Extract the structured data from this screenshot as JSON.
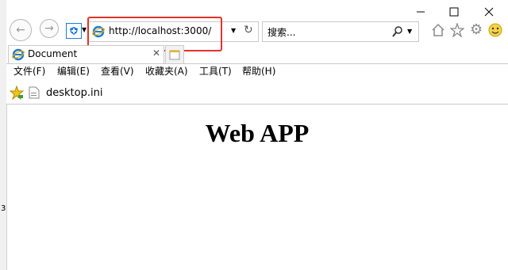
{
  "address_bar": {
    "url": "http://localhost:3000/"
  },
  "search": {
    "placeholder": "搜索..."
  },
  "tab": {
    "title": "Document"
  },
  "menu": {
    "items": [
      "文件(F)",
      "编辑(E)",
      "查看(V)",
      "收藏夹(A)",
      "工具(T)",
      "帮助(H)"
    ]
  },
  "favorites": {
    "item": "desktop.ini"
  },
  "page": {
    "heading": "Web APP"
  },
  "edge_char": "3",
  "colors": {
    "highlight": "#e0342b",
    "ie_blue": "#1e7bd8",
    "ie_gold": "#f0b400"
  },
  "icons": [
    "back-icon",
    "forward-icon",
    "shield-icon",
    "ie-logo-icon",
    "refresh-icon",
    "search-icon",
    "home-icon",
    "star-icon",
    "gear-icon",
    "smiley-icon",
    "minimize-icon",
    "maximize-icon",
    "close-icon",
    "favorites-star-icon",
    "file-icon"
  ]
}
